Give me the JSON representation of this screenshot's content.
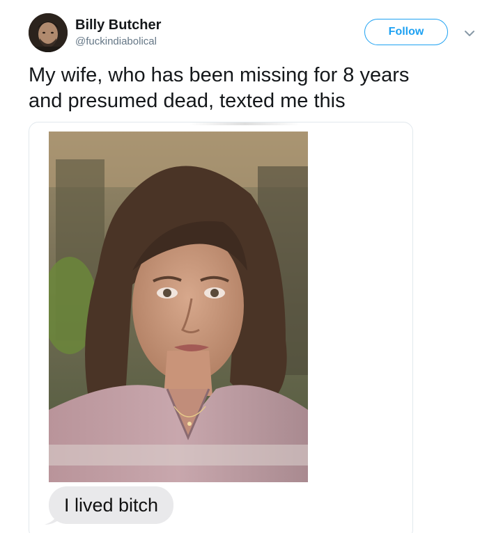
{
  "author": {
    "name": "Billy Butcher",
    "handle": "@fuckindiabolical"
  },
  "actions": {
    "follow_label": "Follow"
  },
  "tweet": {
    "text_line1": "My wife, who has been missing for 8 years",
    "text_line2": "and presumed dead, texted me this"
  },
  "media": {
    "message_text": "I lived bitch"
  },
  "colors": {
    "accent": "#1da1f2",
    "text": "#14171a",
    "secondary": "#657786",
    "bubble": "#e9e9eb",
    "border": "#e1e8ed"
  },
  "icons": {
    "caret": "chevron-down-icon",
    "avatar": "avatar"
  }
}
